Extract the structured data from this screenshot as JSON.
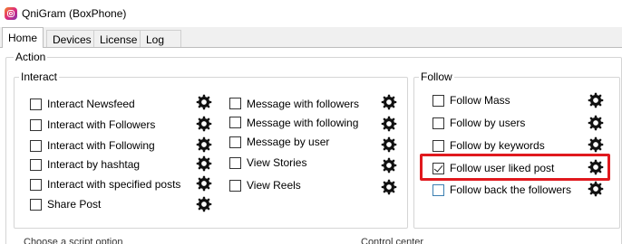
{
  "window": {
    "title": "QniGram (BoxPhone)"
  },
  "tabs": [
    {
      "label": "Home",
      "active": true
    },
    {
      "label": "Devices",
      "active": false
    },
    {
      "label": "License",
      "active": false
    },
    {
      "label": "Log",
      "active": false
    }
  ],
  "action_group": {
    "label": "Action"
  },
  "interact": {
    "label": "Interact",
    "col1": [
      {
        "label": "Interact Newsfeed",
        "checked": false
      },
      {
        "label": "Interact with Followers",
        "checked": false
      },
      {
        "label": "Interact with Following",
        "checked": false
      },
      {
        "label": "Interact by hashtag",
        "checked": false
      },
      {
        "label": "Interact with specified posts",
        "checked": false
      },
      {
        "label": "Share Post",
        "checked": false
      }
    ],
    "col2": [
      {
        "label": "Message with followers",
        "checked": false
      },
      {
        "label": "Message with following",
        "checked": false
      },
      {
        "label": "Message by user",
        "checked": false
      },
      {
        "label": "View Stories",
        "checked": false
      },
      {
        "label": "View Reels",
        "checked": false
      }
    ]
  },
  "follow": {
    "label": "Follow",
    "items": [
      {
        "label": "Follow Mass",
        "checked": false
      },
      {
        "label": "Follow by users",
        "checked": false
      },
      {
        "label": "Follow by keywords",
        "checked": false
      },
      {
        "label": "Follow user liked post",
        "checked": true,
        "highlighted": true
      },
      {
        "label": "Follow back the followers",
        "checked": false
      }
    ]
  },
  "bottom": {
    "script_option": "Choose a script option",
    "control_center": "Control center"
  },
  "colors": {
    "highlight": "#e0191e",
    "accent_checkbox": "#3c7fb1"
  },
  "icons": {
    "settings": "gear-icon",
    "app": "instagram-icon"
  }
}
